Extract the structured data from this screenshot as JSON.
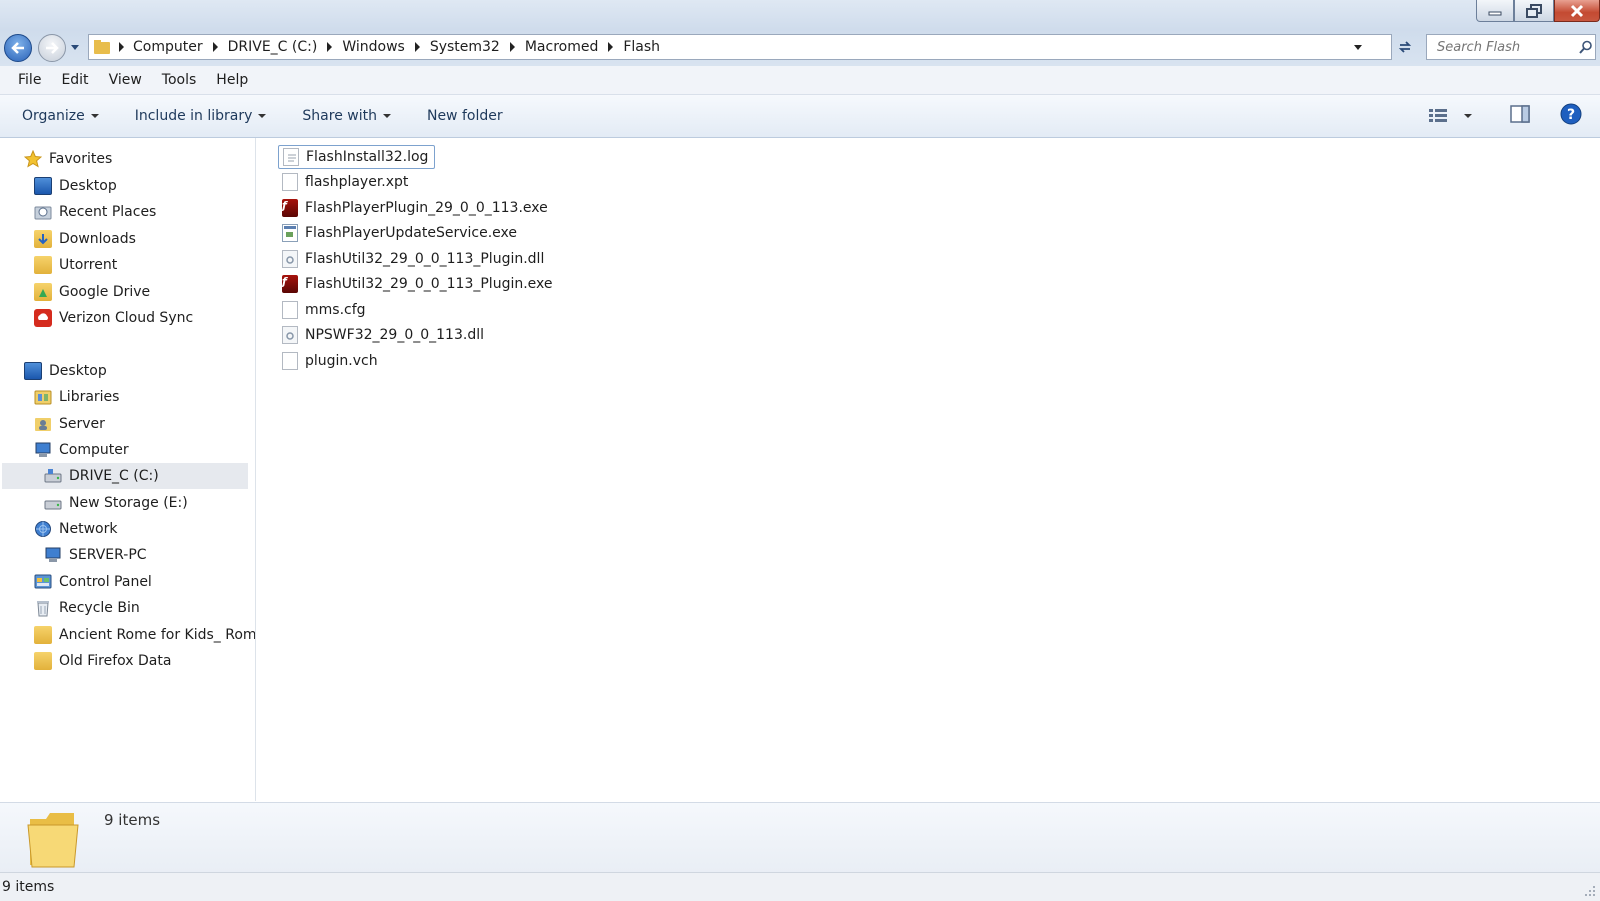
{
  "window": {
    "minimize_icon": "minimize-icon",
    "maximize_icon": "restore-icon",
    "close_icon": "close-icon"
  },
  "address": {
    "crumbs": [
      "Computer",
      "DRIVE_C (C:)",
      "Windows",
      "System32",
      "Macromed",
      "Flash"
    ]
  },
  "search": {
    "placeholder": "Search Flash"
  },
  "menu": {
    "file": "File",
    "edit": "Edit",
    "view": "View",
    "tools": "Tools",
    "help": "Help"
  },
  "commands": {
    "organize": "Organize",
    "include_in_library": "Include in library",
    "share_with": "Share with",
    "new_folder": "New folder"
  },
  "sidebar": {
    "favorites": {
      "header": "Favorites",
      "items": [
        "Desktop",
        "Recent Places",
        "Downloads",
        "Utorrent",
        "Google Drive",
        "Verizon Cloud Sync"
      ]
    },
    "tree": {
      "desktop": "Desktop",
      "libraries": "Libraries",
      "server": "Server",
      "computer": "Computer",
      "drive_c": "DRIVE_C (C:)",
      "new_storage": "New Storage (E:)",
      "network": "Network",
      "server_pc": "SERVER-PC",
      "control_panel": "Control Panel",
      "recycle_bin": "Recycle Bin",
      "ancient_rome": "Ancient Rome for Kids_ Roma",
      "old_firefox": "Old Firefox Data"
    }
  },
  "files": [
    {
      "name": "FlashInstall32.log",
      "icon": "text-file-icon"
    },
    {
      "name": "flashplayer.xpt",
      "icon": "blank-file-icon"
    },
    {
      "name": "FlashPlayerPlugin_29_0_0_113.exe",
      "icon": "flash-icon"
    },
    {
      "name": "FlashPlayerUpdateService.exe",
      "icon": "exe-icon"
    },
    {
      "name": "FlashUtil32_29_0_0_113_Plugin.dll",
      "icon": "dll-icon"
    },
    {
      "name": "FlashUtil32_29_0_0_113_Plugin.exe",
      "icon": "flash-icon"
    },
    {
      "name": "mms.cfg",
      "icon": "blank-file-icon"
    },
    {
      "name": "NPSWF32_29_0_0_113.dll",
      "icon": "dll-icon"
    },
    {
      "name": "plugin.vch",
      "icon": "blank-file-icon"
    }
  ],
  "details": {
    "count": "9 items"
  },
  "status": {
    "text": "9 items"
  },
  "colors": {
    "title_gradient_top": "#dfe8f3",
    "command_text": "#1e395b",
    "selection_bg": "#e6e9ee"
  }
}
